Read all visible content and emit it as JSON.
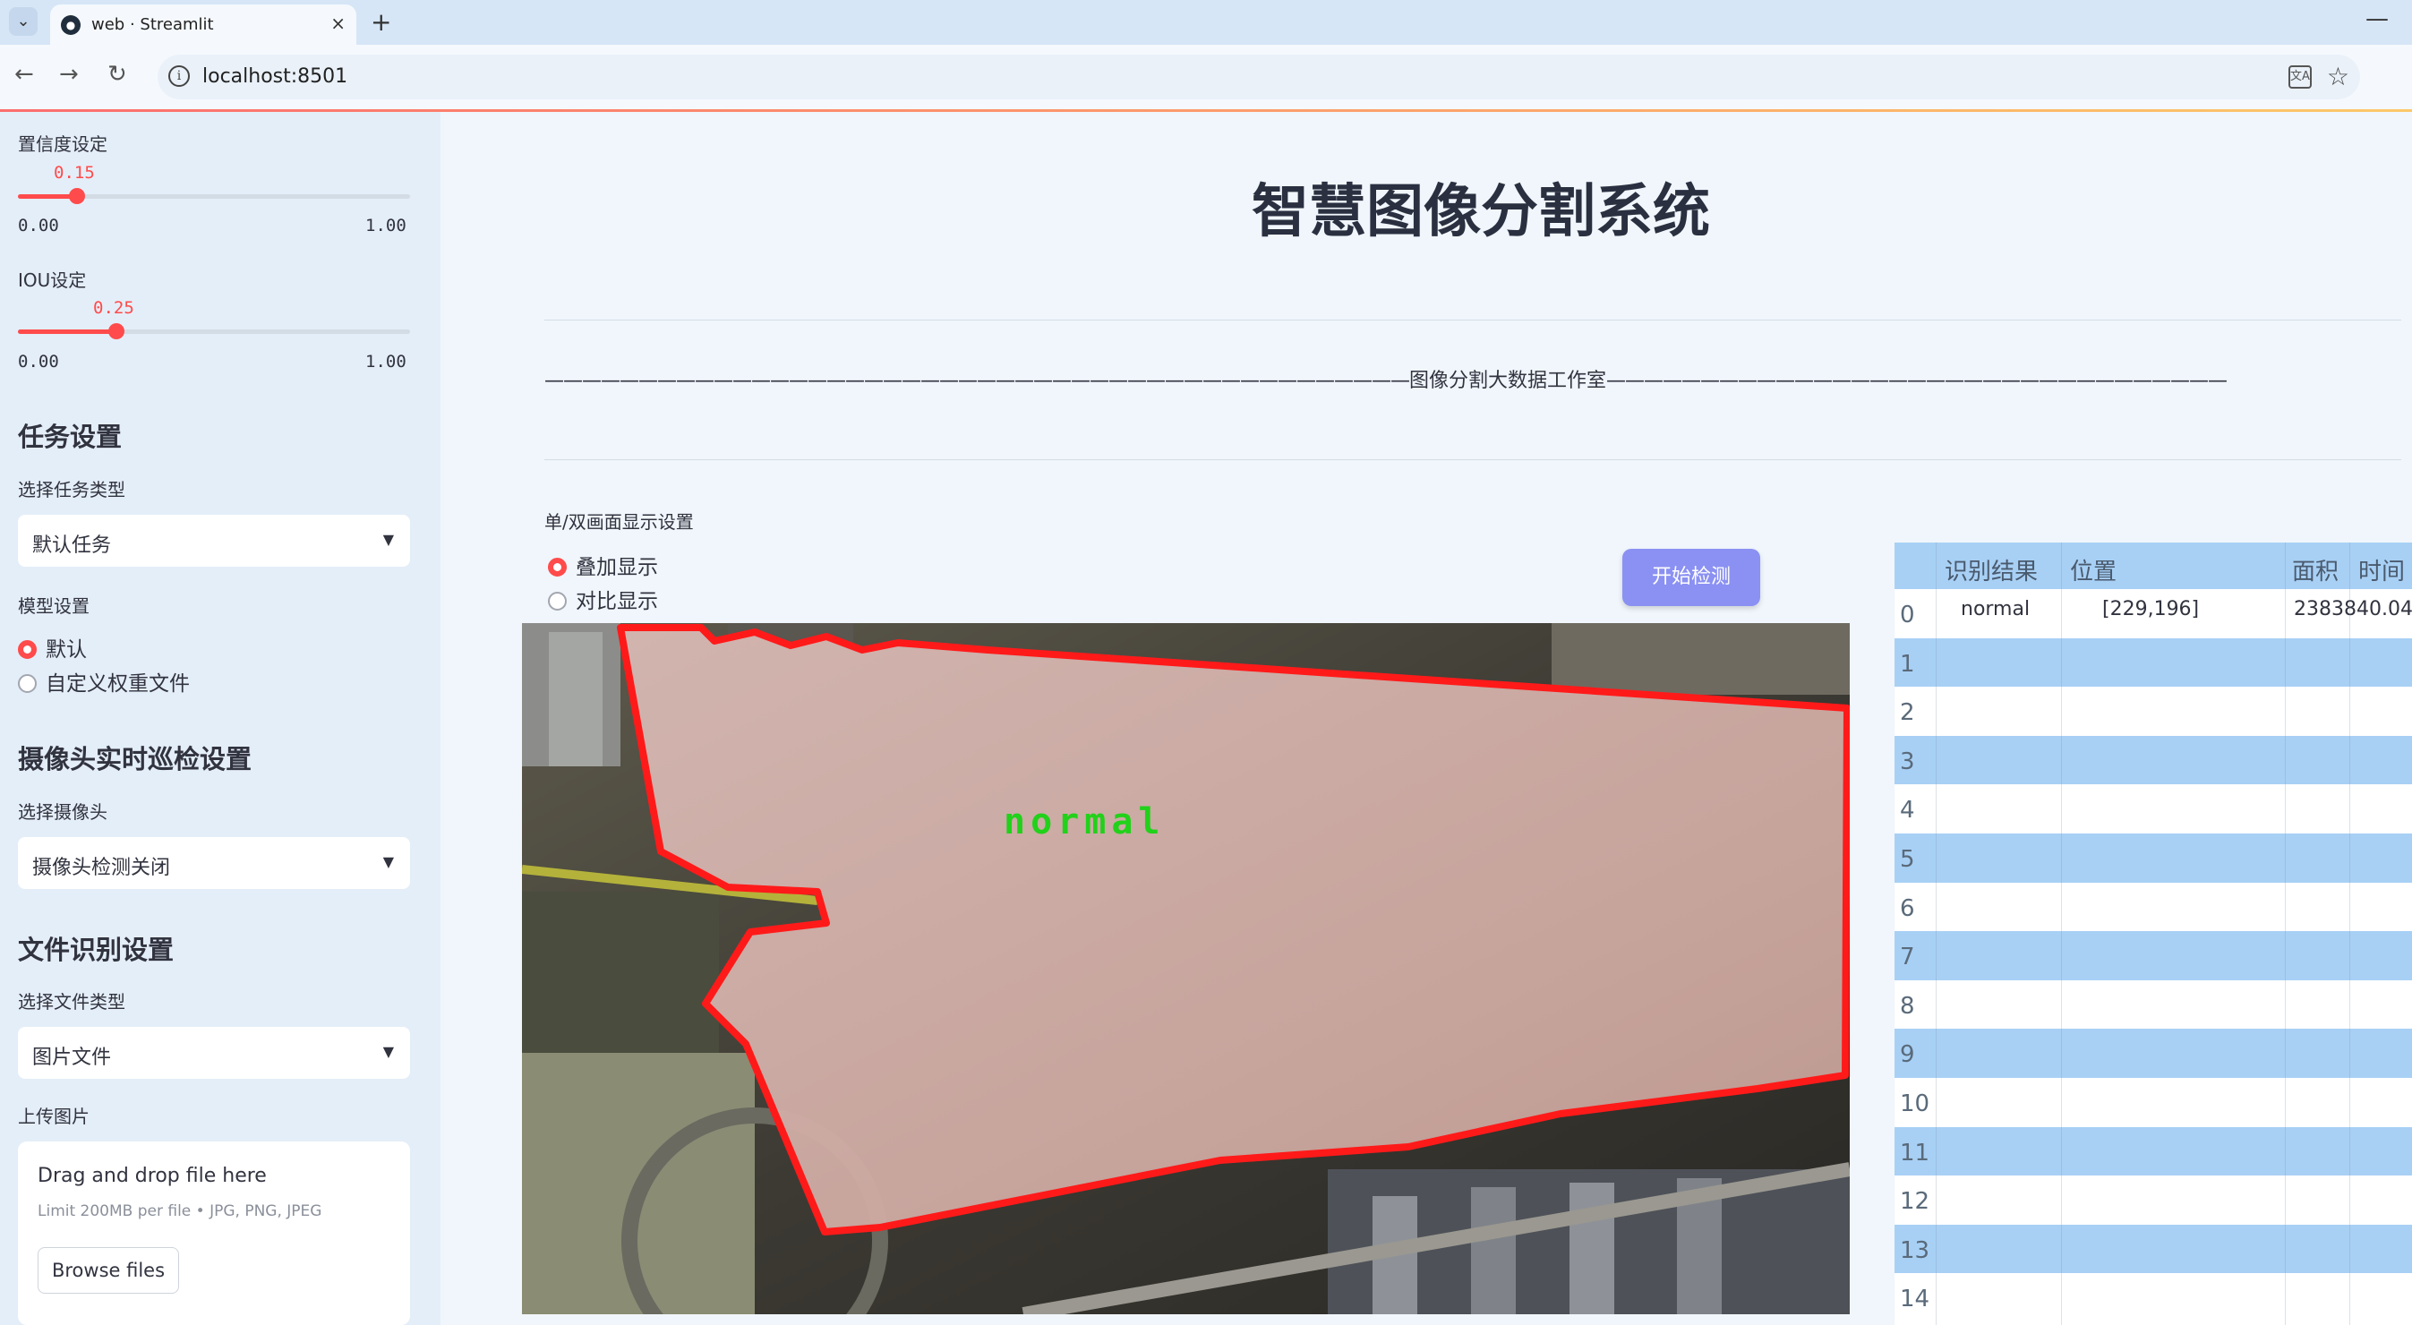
{
  "browser": {
    "tab_title": "web · Streamlit",
    "url": "localhost:8501",
    "tab_close": "×",
    "new_tab": "+",
    "minimize": "—"
  },
  "sidebar": {
    "confidence": {
      "label": "置信度设定",
      "value": "0.15",
      "value_num": 0.15,
      "min": "0.00",
      "max": "1.00"
    },
    "iou": {
      "label": "IOU设定",
      "value": "0.25",
      "value_num": 0.25,
      "min": "0.00",
      "max": "1.00"
    },
    "task_header": "任务设置",
    "task_type_label": "选择任务类型",
    "task_type_value": "默认任务",
    "model_label": "模型设置",
    "model_options": [
      "默认",
      "自定义权重文件"
    ],
    "model_selected": 0,
    "camera_header": "摄像头实时巡检设置",
    "camera_label": "选择摄像头",
    "camera_value": "摄像头检测关闭",
    "file_header": "文件识别设置",
    "file_type_label": "选择文件类型",
    "file_type_value": "图片文件",
    "upload_label": "上传图片",
    "upload_title": "Drag and drop file here",
    "upload_limit": "Limit 200MB per file • JPG, PNG, JPEG",
    "upload_button": "Browse files"
  },
  "main": {
    "title": "智慧图像分割系统",
    "divider_text": "图像分割大数据工作室",
    "display_mode_label": "单/双画面显示设置",
    "display_modes": [
      "叠加显示",
      "对比显示"
    ],
    "display_selected": 0,
    "start_button": "开始检测",
    "detection_label": "normal"
  },
  "colors": {
    "accent": "#ff4b4b",
    "button": "#8b91f2",
    "table_stripe": "#a8d0f5",
    "mask_outline": "#ff1a1a",
    "label_text": "#22d11a"
  },
  "results_table": {
    "columns": [
      "识别结果",
      "位置",
      "面积",
      "时间"
    ],
    "rows": [
      {
        "idx": "0",
        "result": "normal",
        "position": "[229,196]",
        "area": "2383840.04",
        "time": ""
      },
      {
        "idx": "1",
        "result": "",
        "position": "",
        "area": "",
        "time": ""
      },
      {
        "idx": "2",
        "result": "",
        "position": "",
        "area": "",
        "time": ""
      },
      {
        "idx": "3",
        "result": "",
        "position": "",
        "area": "",
        "time": ""
      },
      {
        "idx": "4",
        "result": "",
        "position": "",
        "area": "",
        "time": ""
      },
      {
        "idx": "5",
        "result": "",
        "position": "",
        "area": "",
        "time": ""
      },
      {
        "idx": "6",
        "result": "",
        "position": "",
        "area": "",
        "time": ""
      },
      {
        "idx": "7",
        "result": "",
        "position": "",
        "area": "",
        "time": ""
      },
      {
        "idx": "8",
        "result": "",
        "position": "",
        "area": "",
        "time": ""
      },
      {
        "idx": "9",
        "result": "",
        "position": "",
        "area": "",
        "time": ""
      },
      {
        "idx": "10",
        "result": "",
        "position": "",
        "area": "",
        "time": ""
      },
      {
        "idx": "11",
        "result": "",
        "position": "",
        "area": "",
        "time": ""
      },
      {
        "idx": "12",
        "result": "",
        "position": "",
        "area": "",
        "time": ""
      },
      {
        "idx": "13",
        "result": "",
        "position": "",
        "area": "",
        "time": ""
      },
      {
        "idx": "14",
        "result": "",
        "position": "",
        "area": "",
        "time": ""
      }
    ]
  }
}
